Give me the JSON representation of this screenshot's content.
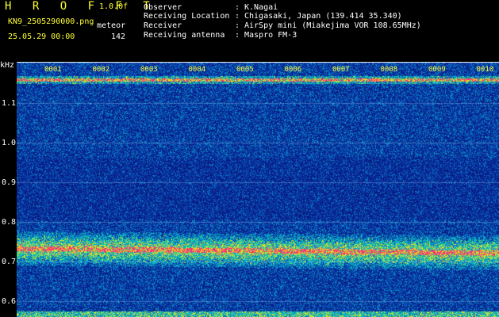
{
  "header": {
    "app_title": "H R O F F T",
    "version": "1.0.0f",
    "filename": "KN9_2505290000.png",
    "type_label": "meteor",
    "datetime": "25.05.29 00:00",
    "count": "142",
    "info": [
      {
        "label": "Observer",
        "colon": ":",
        "value": "K.Nagai"
      },
      {
        "label": "Receiving Location",
        "colon": ":",
        "value": "Chigasaki, Japan (139.414 35.340)"
      },
      {
        "label": "Receiver",
        "colon": ":",
        "value": "AirSpy mini (Miakejima VOR 108.65MHz)"
      },
      {
        "label": "Receiving antenna",
        "colon": ":",
        "value": "Maspro FM-3"
      }
    ]
  },
  "spectrogram": {
    "y_unit": "kHz",
    "y_ticks": [
      {
        "value": 1.1,
        "label": "1.1"
      },
      {
        "value": 1.0,
        "label": "1.0"
      },
      {
        "value": 0.9,
        "label": "0.9"
      },
      {
        "value": 0.8,
        "label": "0.8"
      },
      {
        "value": 0.7,
        "label": "0.7"
      },
      {
        "value": 0.6,
        "label": "0.6"
      }
    ],
    "x_ticks": [
      "0001",
      "0002",
      "0003",
      "0004",
      "0005",
      "0006",
      "0007",
      "0008",
      "0009",
      "0010"
    ],
    "colors": {
      "background": "#0a1f8f",
      "grid": "#6fd0ff",
      "strong": "#ff2a7a",
      "mid": "#ffe600",
      "low": "#30ff90"
    },
    "signal_band_kHz": 0.73,
    "carrier_kHz": 1.16
  }
}
